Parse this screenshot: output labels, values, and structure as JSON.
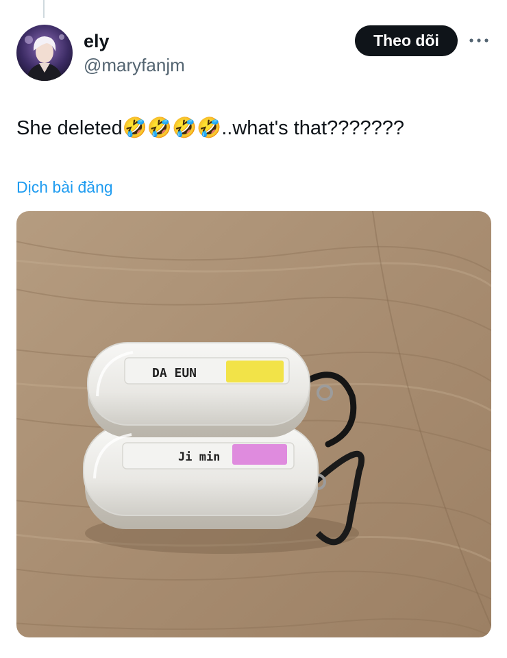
{
  "tweet": {
    "author": {
      "display_name": "ely",
      "handle": "@maryfanjm"
    },
    "follow_label": "Theo dõi",
    "more_icon": "more-horizontal-icon",
    "text": "She deleted🤣🤣🤣🤣..what's that???????",
    "translate_label": "Dịch bài đăng",
    "media": {
      "label_top": "DA EUN",
      "label_bottom": "Ji min",
      "tag_colors": {
        "top": "#f2e23a",
        "bottom": "#dd7fdc"
      }
    }
  },
  "colors": {
    "follow_bg": "#0f1419",
    "link": "#1d9bf0",
    "secondary_text": "#536471"
  }
}
